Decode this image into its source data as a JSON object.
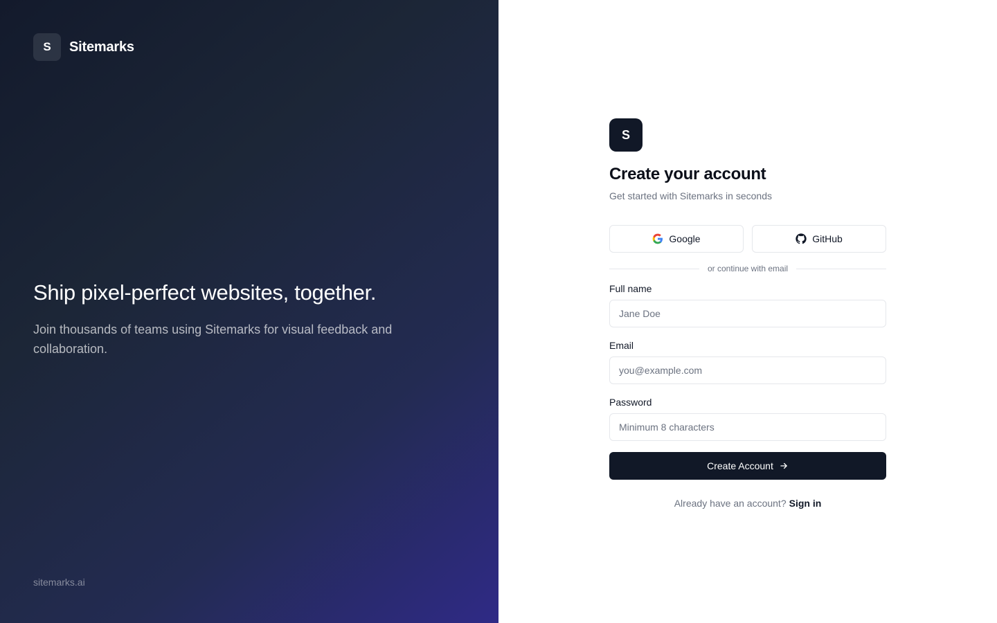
{
  "brand": {
    "initial": "S",
    "name": "Sitemarks"
  },
  "hero": {
    "headline": "Ship pixel-perfect websites, together.",
    "description": "Join thousands of teams using Sitemarks for visual feedback and collaboration."
  },
  "footer": {
    "url": "sitemarks.ai"
  },
  "form": {
    "logo_initial": "S",
    "title": "Create your account",
    "subtitle": "Get started with Sitemarks in seconds",
    "oauth": {
      "google_label": "Google",
      "github_label": "GitHub"
    },
    "divider_text": "or continue with email",
    "fields": {
      "name": {
        "label": "Full name",
        "placeholder": "Jane Doe",
        "value": ""
      },
      "email": {
        "label": "Email",
        "placeholder": "you@example.com",
        "value": ""
      },
      "password": {
        "label": "Password",
        "placeholder": "Minimum 8 characters",
        "value": ""
      }
    },
    "submit_label": "Create Account",
    "signin_prompt": "Already have an account?",
    "signin_link": "Sign in"
  },
  "icons": {
    "google": "google-icon",
    "github": "github-icon",
    "submit_arrow": "arrow-right-icon"
  },
  "colors": {
    "primary": "#111827",
    "muted_text": "#6b7280",
    "border": "#e5e7eb",
    "gradient_start": "#131a2c",
    "gradient_end": "#2f2a86"
  }
}
